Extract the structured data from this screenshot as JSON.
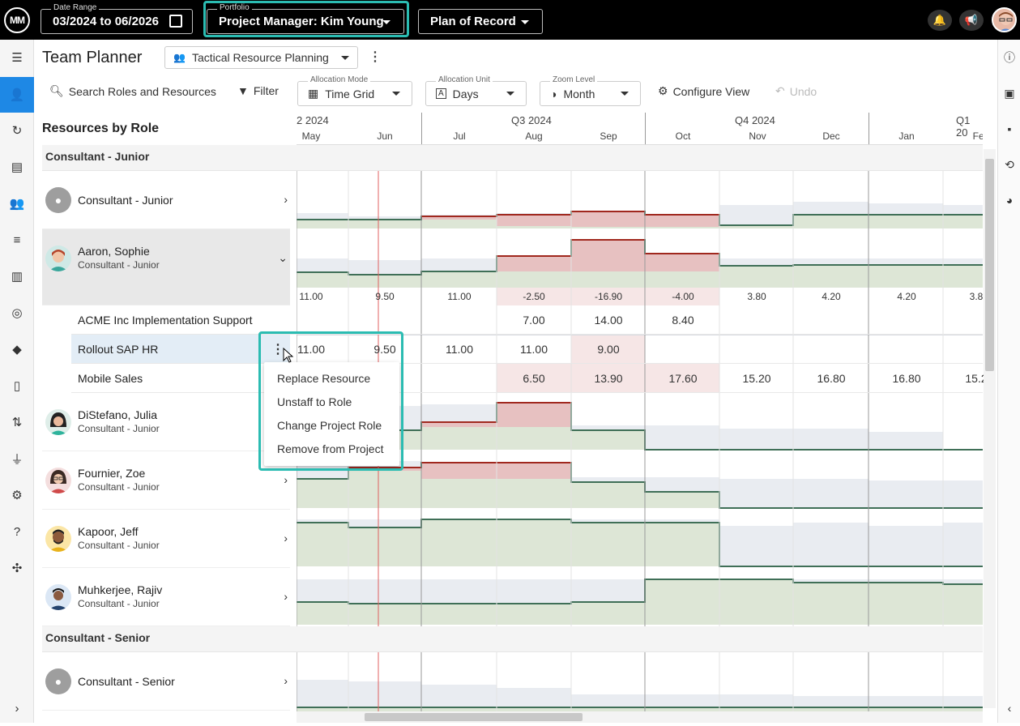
{
  "topbar": {
    "logo_text": "MM",
    "date_range": {
      "label": "Date Range",
      "value": "03/2024 to 06/2026"
    },
    "portfolio": {
      "label": "Portfolio",
      "value": "Project Manager: Kim Young"
    },
    "plan": {
      "value": "Plan of Record"
    }
  },
  "page": {
    "title": "Team Planner",
    "view_selector": "Tactical Resource Planning"
  },
  "toolbar": {
    "search": "Search Roles and Resources",
    "filter": "Filter",
    "allocation_mode": {
      "label": "Allocation Mode",
      "value": "Time Grid"
    },
    "allocation_unit": {
      "label": "Allocation Unit",
      "value": "Days"
    },
    "zoom_level": {
      "label": "Zoom Level",
      "value": "Month"
    },
    "configure": "Configure View",
    "undo": "Undo"
  },
  "grid": {
    "left_header": "Resources by Role",
    "quarters": [
      "2 2024",
      "Q3 2024",
      "Q4 2024",
      "Q1 20"
    ],
    "months": [
      "May",
      "Jun",
      "Jul",
      "Aug",
      "Sep",
      "Oct",
      "Nov",
      "Dec",
      "Jan",
      "Feb"
    ]
  },
  "groups": [
    {
      "name": "Consultant - Junior"
    },
    {
      "name": "Consultant - Senior"
    }
  ],
  "resources": [
    {
      "name": "Consultant - Junior",
      "role": ""
    },
    {
      "name": "Aaron, Sophie",
      "role": "Consultant - Junior"
    },
    {
      "name": "DiStefano, Julia",
      "role": "Consultant - Junior"
    },
    {
      "name": "Fournier, Zoe",
      "role": "Consultant - Junior"
    },
    {
      "name": "Kapoor, Jeff",
      "role": "Consultant - Junior"
    },
    {
      "name": "Muhkerjee, Rajiv",
      "role": "Consultant - Junior"
    },
    {
      "name": "Consultant - Senior",
      "role": ""
    }
  ],
  "aaron_net": [
    "11.00",
    "9.50",
    "11.00",
    "-2.50",
    "-16.90",
    "-4.00",
    "3.80",
    "4.20",
    "4.20",
    "3.8"
  ],
  "projects": [
    {
      "name": "ACME Inc Implementation Support",
      "values": [
        "",
        "",
        "",
        "7.00",
        "14.00",
        "8.40",
        "",
        "",
        "",
        ""
      ]
    },
    {
      "name": "Rollout SAP HR",
      "values": [
        "11.00",
        "9.50",
        "11.00",
        "11.00",
        "9.00",
        "",
        "",
        "",
        "",
        ""
      ]
    },
    {
      "name": "Mobile Sales",
      "values": [
        "",
        "",
        "",
        "6.50",
        "13.90",
        "17.60",
        "15.20",
        "16.80",
        "16.80",
        "15.2"
      ]
    }
  ],
  "context_menu": [
    "Replace Resource",
    "Unstaff to Role",
    "Change Project Role",
    "Remove from Project"
  ],
  "colors": {
    "accent": "#2bbcb2",
    "active_nav": "#1e88e5",
    "over": "#e7c1c1",
    "avail": "#dde6d6",
    "capacity": "#e9ecf1"
  }
}
